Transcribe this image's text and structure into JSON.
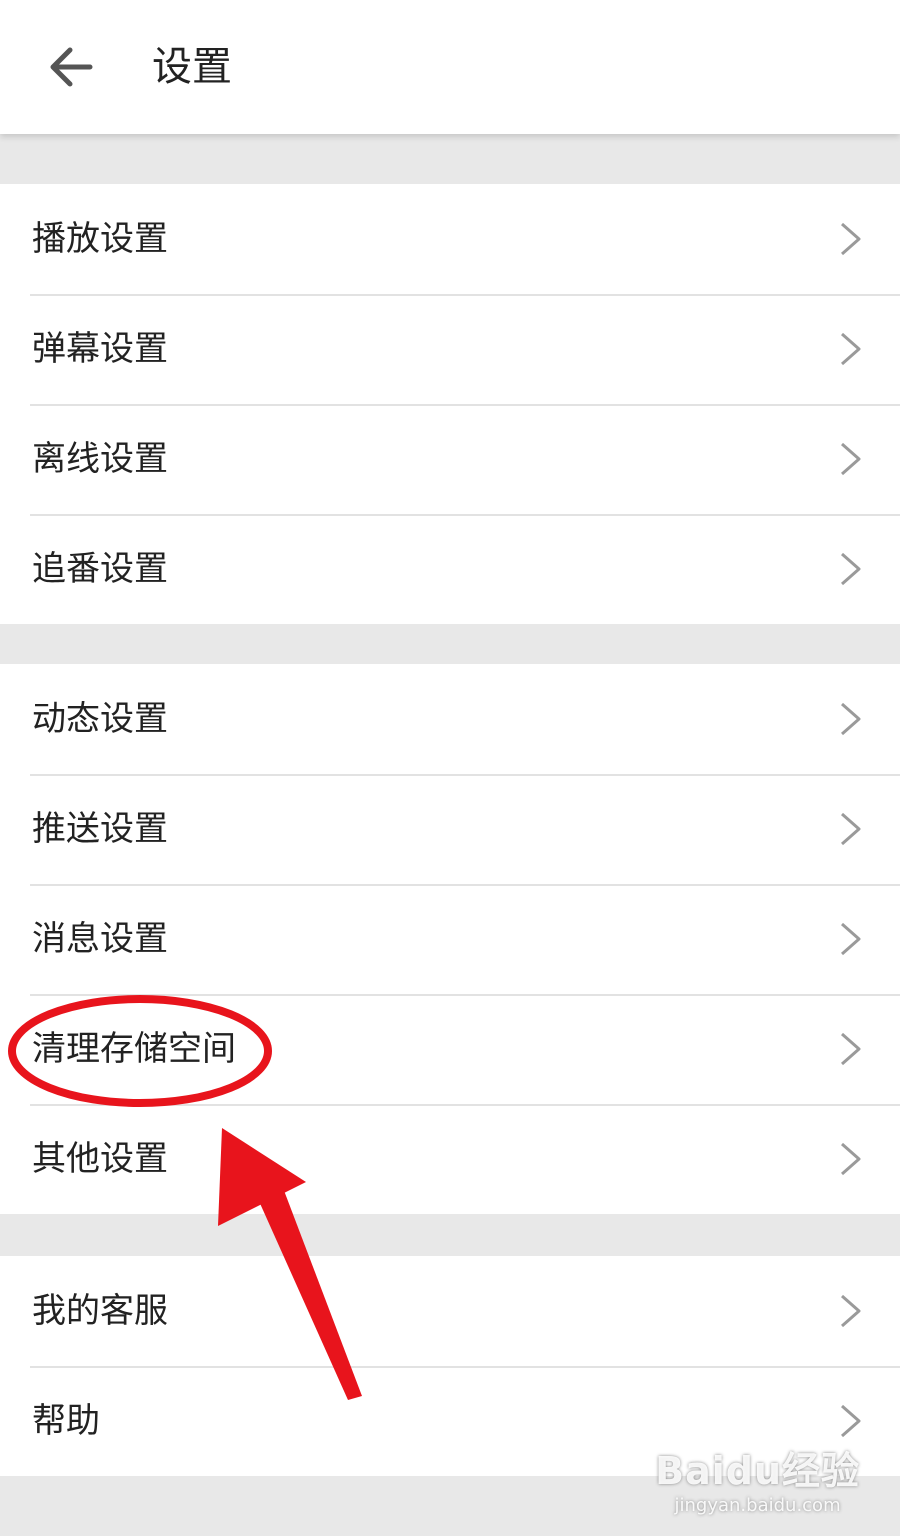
{
  "header": {
    "title": "设置",
    "back_icon": "arrow-left-icon"
  },
  "groups": [
    {
      "items": [
        {
          "label": "播放设置"
        },
        {
          "label": "弹幕设置"
        },
        {
          "label": "离线设置"
        },
        {
          "label": "追番设置"
        }
      ]
    },
    {
      "items": [
        {
          "label": "动态设置"
        },
        {
          "label": "推送设置"
        },
        {
          "label": "消息设置"
        },
        {
          "label": "清理存储空间"
        },
        {
          "label": "其他设置"
        }
      ]
    },
    {
      "items": [
        {
          "label": "我的客服"
        },
        {
          "label": "帮助"
        }
      ]
    }
  ],
  "row_icon": "chevron-right-icon",
  "annotation": {
    "color": "#e8141c",
    "highlighted_item": "清理存储空间"
  },
  "watermark": {
    "logo": "Baidu经验",
    "url": "jingyan.baidu.com"
  },
  "colors": {
    "background": "#e8e8e8",
    "surface": "#ffffff",
    "divider": "#e2e2e2",
    "text": "#222222",
    "chevron": "#9a9a9a"
  }
}
